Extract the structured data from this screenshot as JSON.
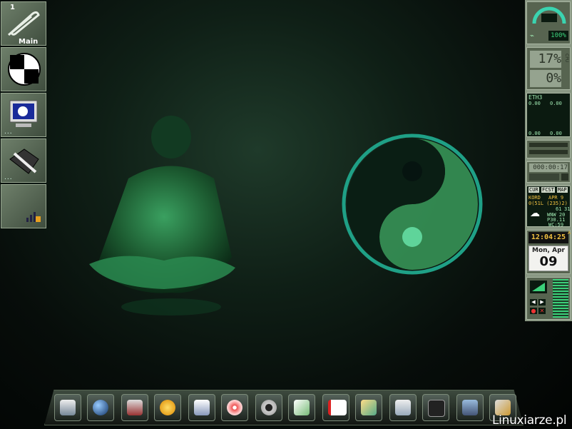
{
  "left_dock": {
    "workspace_number": "1",
    "workspace_label": "Main",
    "dots": "..."
  },
  "right_panel": {
    "batt_percent": "100%",
    "cpu_1": "17%",
    "cpu_2": "0%",
    "cpu_label": "CPU",
    "net_iface": "ETH3",
    "net_rx": "0.00",
    "net_tx": "0.00",
    "net_rx2": "0.00",
    "net_tx2": "0.00",
    "timer": "000:00:17",
    "weather_tabs": [
      "CUR",
      "FCST",
      "MAP"
    ],
    "weather_station": "KORD",
    "weather_date": "APR 9",
    "weather_line2": "0(51L (235)2)",
    "weather_temp": "61",
    "weather_hum": "31",
    "weather_wind": "WNW 20",
    "weather_pressure": "P30.11",
    "weather_wc": "WC:59",
    "clock": "12:04:25",
    "clock_ampm": "A",
    "date_day": "Mon, Apr",
    "date_num": "09"
  },
  "bottom_dock": {
    "icons": [
      "system-settings-icon",
      "globe-browser-icon",
      "joystick-game-icon",
      "chat-bubble-icon",
      "calendar-icon",
      "cd-player-icon",
      "webcam-icon",
      "text-editor-icon",
      "pdf-viewer-icon",
      "image-viewer-icon",
      "file-manager-icon",
      "terminal-icon",
      "network-device-icon",
      "tools-icon"
    ]
  },
  "watermark": "Linuxiarze.pl",
  "colors": {
    "bg_green": "#0f1f16",
    "panel": "#8a9884",
    "lcd": "#3bd07a",
    "accent": "#3ad4b0"
  }
}
